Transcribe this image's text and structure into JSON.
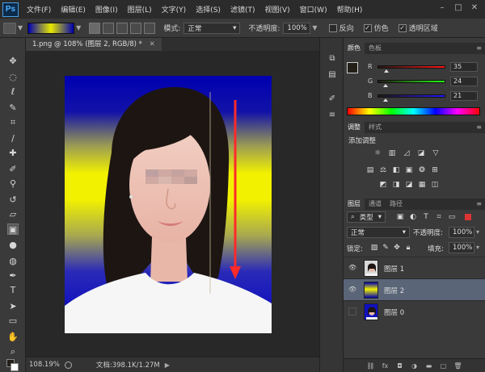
{
  "app": {
    "logo": "Ps",
    "menu": [
      "文件(F)",
      "编辑(E)",
      "图像(I)",
      "图层(L)",
      "文字(Y)",
      "选择(S)",
      "滤镜(T)",
      "视图(V)",
      "窗口(W)",
      "帮助(H)"
    ]
  },
  "options": {
    "mode_label": "模式:",
    "mode_value": "正常",
    "opacity_label": "不透明度:",
    "opacity_value": "100%",
    "reverse_label": "反向",
    "dither_label": "仿色",
    "transparency_label": "透明区域"
  },
  "document": {
    "tab_title": "1.png @ 108% (图层 2, RGB/8) *",
    "zoom": "108.19%",
    "doc_info": "文档:398.1K/1.27M"
  },
  "color_panel": {
    "tabs": [
      "颜色",
      "色板"
    ],
    "channels": [
      {
        "label": "R",
        "value": "35",
        "gradient": "#ff0000"
      },
      {
        "label": "G",
        "value": "24",
        "gradient": "#00ff00"
      },
      {
        "label": "B",
        "value": "21",
        "gradient": "#0000ff"
      }
    ]
  },
  "adjustments_panel": {
    "tabs": [
      "调整",
      "样式"
    ],
    "title": "添加调整"
  },
  "layers_panel": {
    "tabs": [
      "图层",
      "通道",
      "路径"
    ],
    "filter_type": "类型",
    "blend_mode": "正常",
    "opacity_label": "不透明度:",
    "opacity_value": "100%",
    "lock_label": "锁定:",
    "fill_label": "填充:",
    "fill_value": "100%",
    "layers": [
      {
        "name": "图层 1",
        "visible": true,
        "selected": false
      },
      {
        "name": "图层 2",
        "visible": true,
        "selected": true
      },
      {
        "name": "图层 0",
        "visible": false,
        "selected": false
      }
    ]
  },
  "colors": {
    "accent": "#4aa0e6",
    "selection": "#5a6578",
    "arrow": "#ff2a2a",
    "gradient_blue": "#0000b0",
    "gradient_yellow": "#f2f200"
  }
}
